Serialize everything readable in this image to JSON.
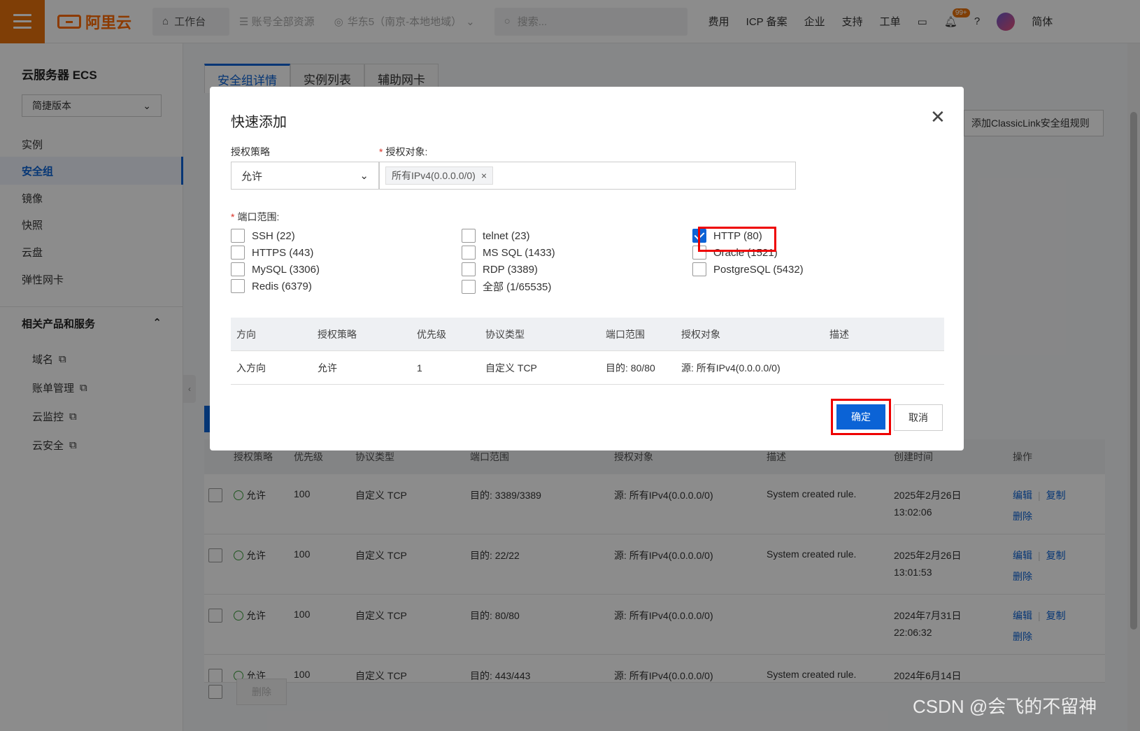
{
  "topbar": {
    "logo": "阿里云",
    "workbench": "工作台",
    "resources": "账号全部资源",
    "region": "华东5（南京-本地地域）",
    "search_placeholder": "搜索...",
    "links": [
      "费用",
      "ICP 备案",
      "企业",
      "支持",
      "工单"
    ],
    "notification_badge": "99+",
    "language": "简体"
  },
  "sidebar": {
    "title": "云服务器 ECS",
    "edition": "简捷版本",
    "items": [
      {
        "label": "实例"
      },
      {
        "label": "安全组"
      },
      {
        "label": "镜像"
      },
      {
        "label": "快照"
      },
      {
        "label": "云盘"
      },
      {
        "label": "弹性网卡"
      }
    ],
    "group_title": "相关产品和服务",
    "sub_items": [
      {
        "label": "域名"
      },
      {
        "label": "账单管理"
      },
      {
        "label": "云监控"
      },
      {
        "label": "云安全"
      }
    ]
  },
  "main": {
    "tabs": [
      "安全组详情",
      "实例列表",
      "辅助网卡"
    ],
    "classiclink_button": "添加ClassicLink安全组规则",
    "table_headers": [
      "授权策略",
      "优先级",
      "协议类型",
      "端口范围",
      "授权对象",
      "描述",
      "创建时间",
      "操作"
    ],
    "rows": [
      {
        "policy": "允许",
        "priority": "100",
        "protocol": "自定义 TCP",
        "port": "目的: 3389/3389",
        "target": "源: 所有IPv4(0.0.0.0/0)",
        "desc": "System created rule.",
        "date": "2025年2月26日",
        "time": "13:02:06"
      },
      {
        "policy": "允许",
        "priority": "100",
        "protocol": "自定义 TCP",
        "port": "目的: 22/22",
        "target": "源: 所有IPv4(0.0.0.0/0)",
        "desc": "System created rule.",
        "date": "2025年2月26日",
        "time": "13:01:53"
      },
      {
        "policy": "允许",
        "priority": "100",
        "protocol": "自定义 TCP",
        "port": "目的: 80/80",
        "target": "源: 所有IPv4(0.0.0.0/0)",
        "desc": "",
        "date": "2024年7月31日",
        "time": "22:06:32"
      },
      {
        "policy": "允许",
        "priority": "100",
        "protocol": "自定义 TCP",
        "port": "目的: 443/443",
        "target": "源: 所有IPv4(0.0.0.0/0)",
        "desc": "System created rule.",
        "date": "2024年6月14日",
        "time": ""
      }
    ],
    "action_edit": "编辑",
    "action_copy": "复制",
    "action_delete": "删除",
    "bulk_delete": "删除"
  },
  "modal": {
    "title": "快速添加",
    "policy_label": "授权策略",
    "policy_value": "允许",
    "target_label": "授权对象:",
    "target_tag": "所有IPv4(0.0.0.0/0)",
    "port_label": "端口范围:",
    "ports": [
      {
        "label": "SSH (22)",
        "checked": false
      },
      {
        "label": "telnet (23)",
        "checked": false
      },
      {
        "label": "HTTP (80)",
        "checked": true
      },
      {
        "label": "HTTPS (443)",
        "checked": false
      },
      {
        "label": "MS SQL (1433)",
        "checked": false
      },
      {
        "label": "Oracle (1521)",
        "checked": false
      },
      {
        "label": "MySQL (3306)",
        "checked": false
      },
      {
        "label": "RDP (3389)",
        "checked": false
      },
      {
        "label": "PostgreSQL (5432)",
        "checked": false
      },
      {
        "label": "Redis (6379)",
        "checked": false
      },
      {
        "label": "全部 (1/65535)",
        "checked": false
      }
    ],
    "table_headers": [
      "方向",
      "授权策略",
      "优先级",
      "协议类型",
      "端口范围",
      "授权对象",
      "描述"
    ],
    "table_row": [
      "入方向",
      "允许",
      "1",
      "自定义 TCP",
      "目的: 80/80",
      "源: 所有IPv4(0.0.0.0/0)",
      ""
    ],
    "ok_label": "确定",
    "cancel_label": "取消"
  },
  "watermark": "CSDN @会飞的不留神",
  "colors": {
    "brand": "#ff6a00",
    "primary": "#0b63d6",
    "highlight": "#ee0000"
  }
}
